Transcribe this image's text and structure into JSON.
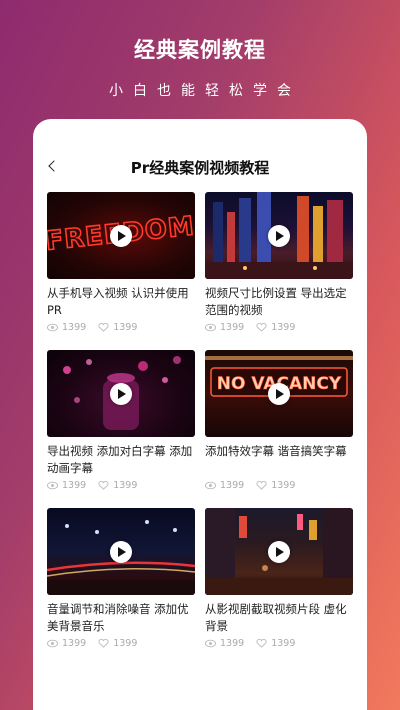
{
  "promo": {
    "title": "经典案例教程",
    "subtitle": "小白也能轻松学会"
  },
  "nav": {
    "back_icon": "chevron-left-icon",
    "title": "Pr经典案例视频教程"
  },
  "videos": [
    {
      "title": "从手机导入视频 认识并使用PR",
      "views": "1399",
      "likes": "1399",
      "thumb_text": "FREEDOM"
    },
    {
      "title": "视频尺寸比例设置 导出选定范围的视频",
      "views": "1399",
      "likes": "1399"
    },
    {
      "title": "导出视频 添加对白字幕 添加动画字幕",
      "views": "1399",
      "likes": "1399"
    },
    {
      "title": "添加特效字幕 谐音搞笑字幕",
      "views": "1399",
      "likes": "1399",
      "thumb_text": "NO VACANCY"
    },
    {
      "title": "音量调节和消除噪音 添加优美背景音乐",
      "views": "1399",
      "likes": "1399"
    },
    {
      "title": "从影视剧截取视频片段 虚化背景",
      "views": "1399",
      "likes": "1399"
    }
  ],
  "colors": {
    "gradient_start": "#8e2b6e",
    "gradient_end": "#f27a5c",
    "meta_text": "#aaaaaa"
  }
}
